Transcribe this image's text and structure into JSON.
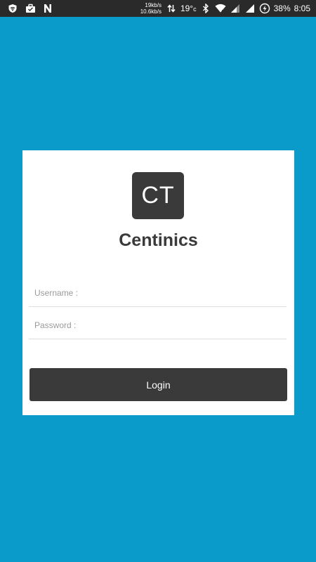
{
  "status_bar": {
    "icons_left": [
      "vpn-shield-icon",
      "work-briefcase-icon",
      "n-notification-icon"
    ],
    "net_speed_up": "19kb/s",
    "net_speed_down": "10.6kb/s",
    "temperature": "19°",
    "temperature_unit": "c",
    "icons_right": [
      "data-arrows-icon",
      "bluetooth-icon",
      "wifi-icon",
      "signal-icon",
      "battery-saver-icon"
    ],
    "battery_percent": "38%",
    "time": "8:05"
  },
  "login": {
    "logo_text": "CT",
    "app_name": "Centinics",
    "username_placeholder": "Username :",
    "password_placeholder": "Password :",
    "login_label": "Login"
  },
  "colors": {
    "background": "#0b9bcb",
    "status_bar": "#2a2a2a",
    "card": "#ffffff",
    "dark_accent": "#3a3a3a"
  }
}
